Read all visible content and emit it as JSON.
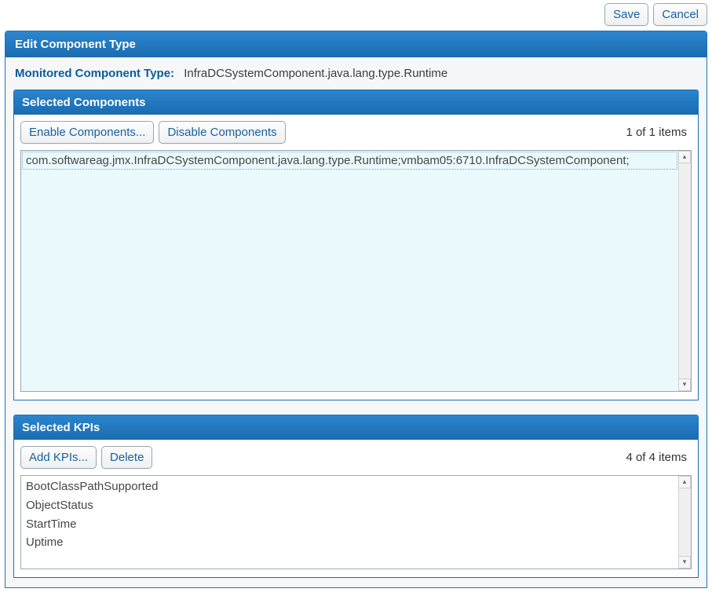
{
  "toolbar": {
    "save_label": "Save",
    "cancel_label": "Cancel"
  },
  "panel": {
    "title": "Edit Component Type",
    "monitored_label": "Monitored Component Type:",
    "monitored_value": "InfraDCSystemComponent.java.lang.type.Runtime"
  },
  "components": {
    "header": "Selected Components",
    "enable_label": "Enable Components...",
    "disable_label": "Disable Components",
    "count_text": "1 of 1 items",
    "items": [
      "com.softwareag.jmx.InfraDCSystemComponent.java.lang.type.Runtime;vmbam05:6710.InfraDCSystemComponent;"
    ]
  },
  "kpis": {
    "header": "Selected KPIs",
    "add_label": "Add KPIs...",
    "delete_label": "Delete",
    "count_text": "4 of 4 items",
    "items": [
      "BootClassPathSupported",
      "ObjectStatus",
      "StartTime",
      "Uptime"
    ]
  }
}
